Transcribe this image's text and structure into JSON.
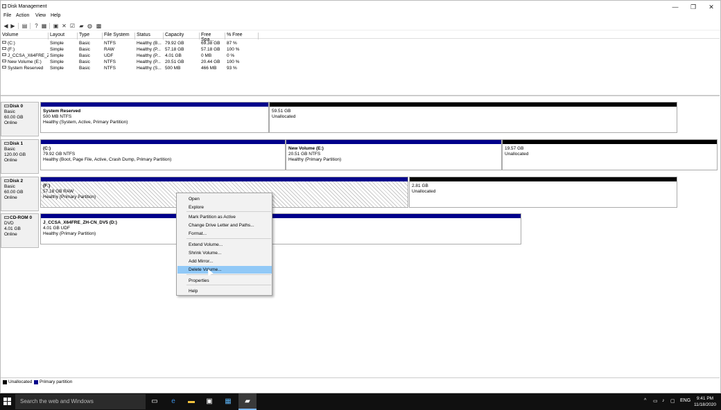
{
  "window": {
    "title": "Disk Management",
    "controls": [
      "—",
      "❐",
      "✕"
    ]
  },
  "menu": [
    "File",
    "Action",
    "View",
    "Help"
  ],
  "columns": [
    "Volume",
    "Layout",
    "Type",
    "File System",
    "Status",
    "Capacity",
    "Free Spa...",
    "% Free"
  ],
  "volumes": [
    [
      "(C:)",
      "Simple",
      "Basic",
      "NTFS",
      "Healthy (B...",
      "79.92 GB",
      "69.38 GB",
      "87 %"
    ],
    [
      "(F:)",
      "Simple",
      "Basic",
      "RAW",
      "Healthy (P...",
      "57.18 GB",
      "57.18 GB",
      "100 %"
    ],
    [
      "J_CCSA_X64FRE_Z...",
      "Simple",
      "Basic",
      "UDF",
      "Healthy (P...",
      "4.01 GB",
      "0 MB",
      "0 %"
    ],
    [
      "New Volume (E:)",
      "Simple",
      "Basic",
      "NTFS",
      "Healthy (P...",
      "20.51 GB",
      "20.44 GB",
      "100 %"
    ],
    [
      "System Reserved",
      "Simple",
      "Basic",
      "NTFS",
      "Healthy (S...",
      "500 MB",
      "466 MB",
      "93 %"
    ]
  ],
  "disks": [
    {
      "name": "Disk 0",
      "type": "Basic",
      "size": "60.00 GB",
      "status": "Online",
      "partitions": [
        {
          "name": "System Reserved",
          "size": "500 MB NTFS",
          "status": "Healthy (System, Active, Primary Partition)",
          "kind": "primary"
        },
        {
          "name": "",
          "size": "59.51 GB",
          "status": "Unallocated",
          "kind": "unallocated"
        }
      ]
    },
    {
      "name": "Disk 1",
      "type": "Basic",
      "size": "120.00 GB",
      "status": "Online",
      "partitions": [
        {
          "name": "(C:)",
          "size": "79.92 GB NTFS",
          "status": "Healthy (Boot, Page File, Active, Crash Dump, Primary Partition)",
          "kind": "primary"
        },
        {
          "name": "New Volume  (E:)",
          "size": "20.51 GB NTFS",
          "status": "Healthy (Primary Partition)",
          "kind": "primary"
        },
        {
          "name": "",
          "size": "19.57 GB",
          "status": "Unallocated",
          "kind": "unallocated"
        }
      ]
    },
    {
      "name": "Disk 2",
      "type": "Basic",
      "size": "60.00 GB",
      "status": "Online",
      "partitions": [
        {
          "name": "(F:)",
          "size": "57.18 GB RAW",
          "status": "Healthy (Primary Partition)",
          "kind": "primary-selected"
        },
        {
          "name": "",
          "size": "2.81 GB",
          "status": "Unallocated",
          "kind": "unallocated"
        }
      ]
    },
    {
      "name": "CD-ROM 0",
      "type": "DVD",
      "size": "4.01 GB",
      "status": "Online",
      "partitions": [
        {
          "name": "J_CCSA_X64FRE_ZH-CN_DV5  (D:)",
          "size": "4.01 GB UDF",
          "status": "Healthy (Primary Partition)",
          "kind": "primary"
        }
      ]
    }
  ],
  "context_menu": {
    "items": [
      "Open",
      "Explore",
      "Mark Partition as Active",
      "Change Drive Letter and Paths...",
      "Format...",
      "Extend Volume...",
      "Shrink Volume...",
      "Add Mirror...",
      "Delete Volume...",
      "Properties",
      "Help"
    ],
    "highlighted": "Delete Volume..."
  },
  "legend": [
    {
      "label": "Unallocated",
      "color": "#000000"
    },
    {
      "label": "Primary partition",
      "color": "#00008b"
    }
  ],
  "taskbar": {
    "search_placeholder": "Search the web and Windows",
    "language": "ENG",
    "time": "9:41 PM",
    "date": "11/18/2020"
  },
  "colors": {
    "primary": "#00008b",
    "unallocated": "#000000",
    "highlight": "#91c9f7"
  }
}
